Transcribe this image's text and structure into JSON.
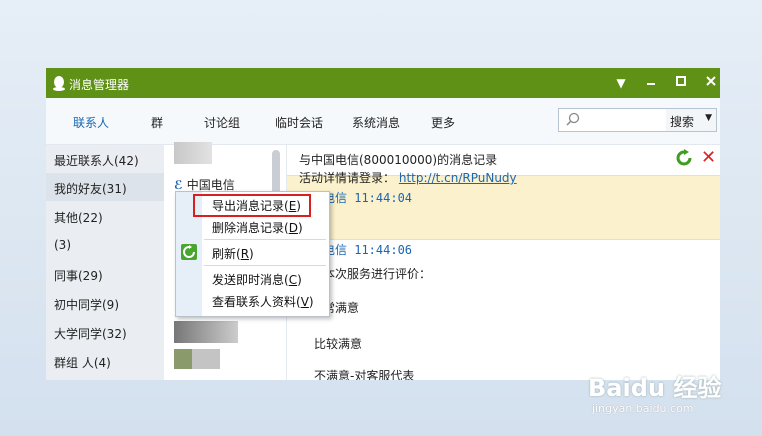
{
  "window": {
    "title": "消息管理器"
  },
  "tabs": [
    {
      "label": "联系人"
    },
    {
      "label": "群"
    },
    {
      "label": "讨论组"
    },
    {
      "label": "临时会话"
    },
    {
      "label": "系统消息"
    },
    {
      "label": "更多"
    }
  ],
  "search": {
    "button": "搜索",
    "placeholder": ""
  },
  "groups": [
    {
      "label": "最近联系人(42)"
    },
    {
      "label": "我的好友(31)"
    },
    {
      "label": "其他(22)"
    },
    {
      "label": "(3)"
    },
    {
      "label": "同事(29)"
    },
    {
      "label": "初中同学(9)"
    },
    {
      "label": "大学同学(32)"
    },
    {
      "label": "群组 人(4)"
    }
  ],
  "contact": {
    "name": "中国电信"
  },
  "message_pane": {
    "title": "与中国电信(800010000)的消息记录",
    "lines": [
      {
        "text": "活动详情请登录：",
        "link": "http://t.cn/RPuNudy"
      },
      {
        "sender": "电信 11:44:04"
      },
      {
        "sender": "电信 11:44:06"
      },
      {
        "text": "本次服务进行评价："
      },
      {
        "text": "常满意"
      },
      {
        "text": "比较满意"
      },
      {
        "text": "不满意-对客服代表"
      }
    ]
  },
  "context_menu": {
    "items": [
      {
        "label": "导出消息记录(",
        "key": "E",
        "end": ")"
      },
      {
        "label": "删除消息记录(",
        "key": "D",
        "end": ")"
      },
      {
        "label": "刷新(",
        "key": "R",
        "end": ")"
      },
      {
        "label": "发送即时消息(",
        "key": "C",
        "end": ")"
      },
      {
        "label": "查看联系人资料(",
        "key": "V",
        "end": ")"
      }
    ]
  },
  "watermark": {
    "main": "Baidu 经验",
    "sub": "jingyan.baidu.com"
  },
  "colors": {
    "titlebar": "#5e9116",
    "accent": "#1767b0",
    "highlight_box": "#d92020"
  }
}
